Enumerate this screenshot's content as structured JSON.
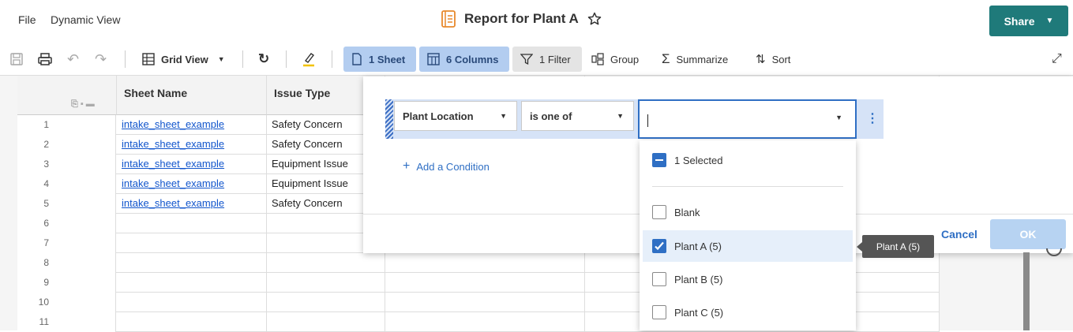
{
  "menu": {
    "file": "File",
    "dynamic_view": "Dynamic View"
  },
  "header": {
    "title": "Report for Plant A",
    "share_label": "Share"
  },
  "toolbar": {
    "view_label": "Grid View",
    "sheets_label": "1 Sheet",
    "columns_label": "6 Columns",
    "filter_label": "1 Filter",
    "group_label": "Group",
    "summarize_label": "Summarize",
    "sort_label": "Sort"
  },
  "grid": {
    "columns": [
      "Sheet Name",
      "Issue Type"
    ],
    "rows": [
      {
        "num": "1",
        "sheet": "intake_sheet_example",
        "issue": "Safety Concern"
      },
      {
        "num": "2",
        "sheet": "intake_sheet_example",
        "issue": "Safety Concern"
      },
      {
        "num": "3",
        "sheet": "intake_sheet_example",
        "issue": "Equipment Issue"
      },
      {
        "num": "4",
        "sheet": "intake_sheet_example",
        "issue": "Equipment Issue"
      },
      {
        "num": "5",
        "sheet": "intake_sheet_example",
        "issue": "Safety Concern"
      },
      {
        "num": "6",
        "sheet": "",
        "issue": ""
      },
      {
        "num": "7",
        "sheet": "",
        "issue": ""
      },
      {
        "num": "8",
        "sheet": "",
        "issue": ""
      },
      {
        "num": "9",
        "sheet": "",
        "issue": ""
      },
      {
        "num": "10",
        "sheet": "",
        "issue": ""
      },
      {
        "num": "11",
        "sheet": "",
        "issue": ""
      }
    ]
  },
  "filter": {
    "field": "Plant Location",
    "operator": "is one of",
    "value": "",
    "add_condition": "Add a Condition",
    "cancel_label": "Cancel",
    "ok_label": "OK",
    "selected_summary": "1 Selected",
    "options": [
      {
        "label": "Blank",
        "checked": false
      },
      {
        "label": "Plant A (5)",
        "checked": true
      },
      {
        "label": "Plant B (5)",
        "checked": false
      },
      {
        "label": "Plant C (5)",
        "checked": false
      }
    ],
    "tooltip": "Plant A (5)"
  },
  "colors": {
    "accent": "#2f6fc4",
    "share": "#1f7a7a",
    "pill": "#b3cdf0"
  }
}
